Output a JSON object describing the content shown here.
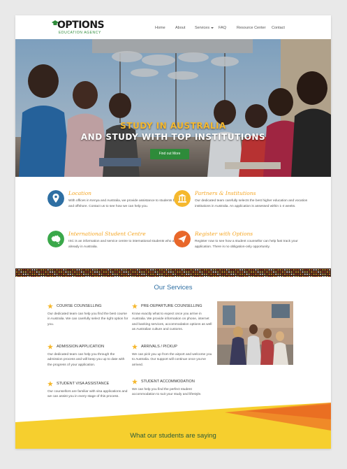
{
  "brand": {
    "name": "OPTIONS",
    "tagline": "EDUCATION AGENCY"
  },
  "nav": {
    "items": [
      "Home",
      "About",
      "Services",
      "FAQ",
      "Resource Center",
      "Contact"
    ]
  },
  "hero": {
    "line1": "STUDY IN AUSTRALIA",
    "line2": "AND STUDY WITH TOP INSTITUTIONS",
    "button": "Find out More"
  },
  "features": [
    {
      "title": "Location",
      "text": "With offices in Kenya and Australia, we provide assistance to students both on and offshore. Contact us to see how we can help you.",
      "icon": "map-pin-icon",
      "color": "#2e6fa3"
    },
    {
      "title": "Partners & Institutions",
      "text": "Our dedicated team carefully selects the best higher education and vocation institutions in Australia. An application is assessed within 1-4 weeks.",
      "icon": "institution-icon",
      "color": "#f5b82e"
    },
    {
      "title": "International Student Centre",
      "text": "ISC is an information and service centre to international students who are already in Australia.",
      "icon": "australia-map-icon",
      "color": "#3aa84a"
    },
    {
      "title": "Register with Options",
      "text": "Register now to see how a student counsellor can help fast track your application. There is no obligation-only opportunity.",
      "icon": "paper-plane-icon",
      "color": "#e8672a"
    }
  ],
  "services": {
    "title": "Our Services",
    "items": [
      {
        "title": "COURSE COUNSELLING",
        "text": "Our dedicated team can help you find the best course in Australia. We can carefully select the right option for you."
      },
      {
        "title": "PRE-DEPARTURE COUNSELLING",
        "text": "Know exactly what to expect once you arrive in Australia. We provide information on phone, internet and banking services, accommodation options as well as Australian culture and customs."
      },
      {
        "title": "ADMISSION APPLICATION",
        "text": "Our dedicated team can help you through the admission process and will keep you up to date with the progress of your application."
      },
      {
        "title": "ARRIVALS / PICKUP",
        "text": "We can pick you up from the airport and welcome you to Australia. Our support will continue once you've arrived."
      },
      {
        "title": "STUDENT VISA ASSISTANCE",
        "text": "Our counsellors are familiar with visa applications and we can assist you in every stage of this process."
      },
      {
        "title": "STUDENT ACCOMMODATION",
        "text": "We can help you find the perfect student accommodation to suit your study and lifestyle."
      }
    ]
  },
  "testimonials": {
    "title": "What our students are saying"
  },
  "colors": {
    "green": "#2e8b3a",
    "gold": "#f5b82e",
    "orange": "#e8672a",
    "blue": "#2e6fa3",
    "yellow_band": "#f6cf2e"
  }
}
